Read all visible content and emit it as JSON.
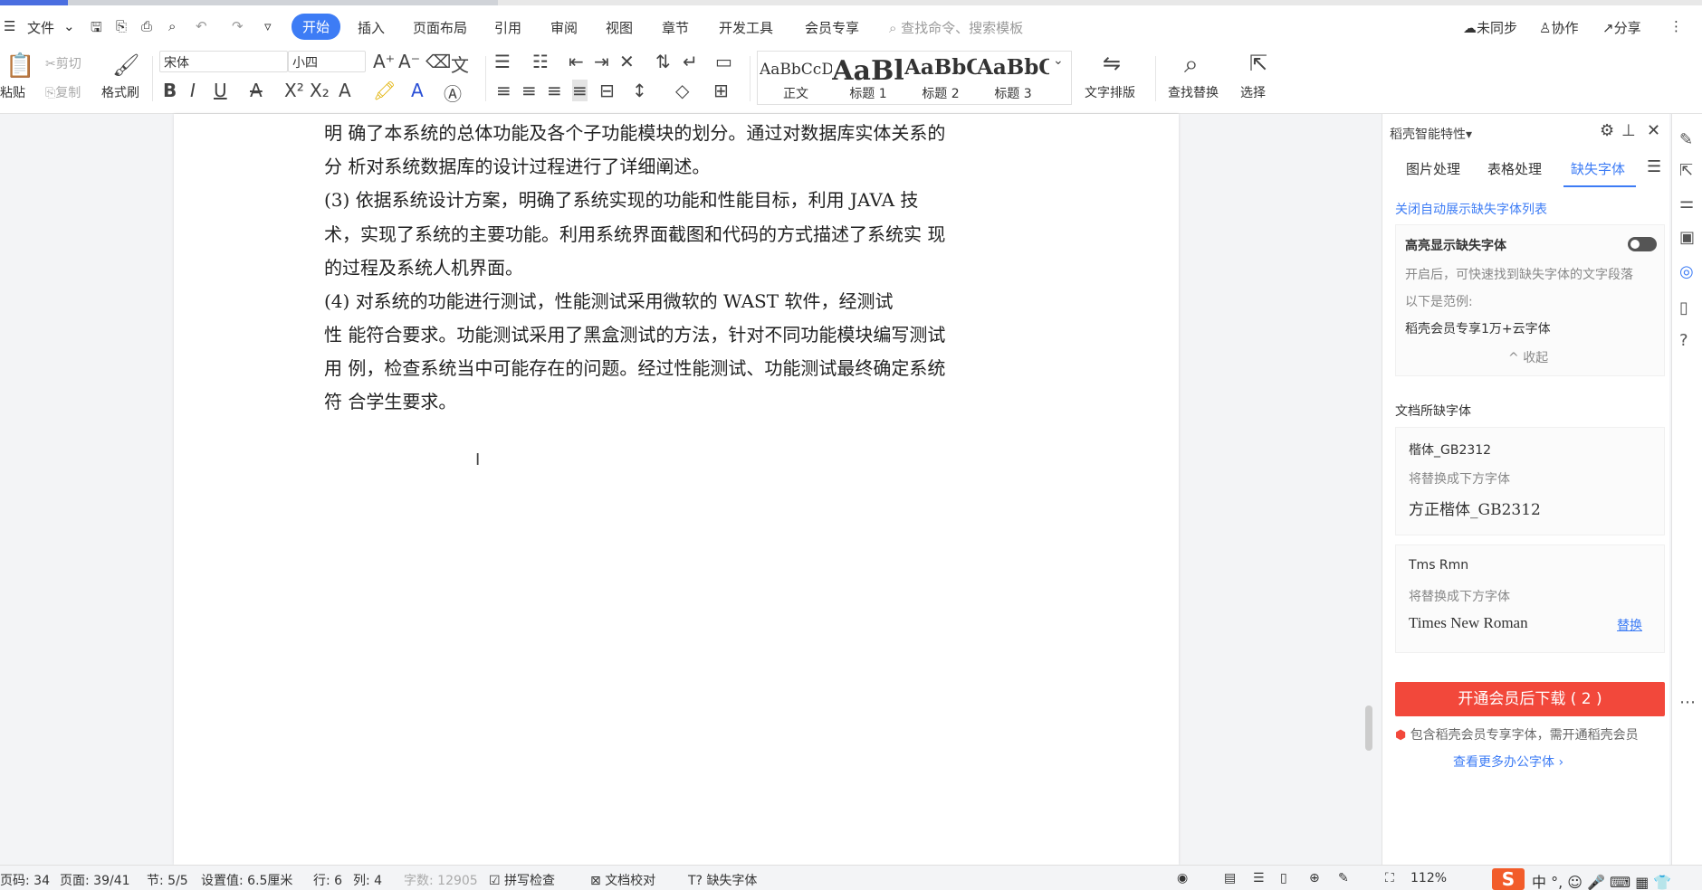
{
  "menubar": {
    "file": "文件",
    "tabs": [
      "开始",
      "插入",
      "页面布局",
      "引用",
      "审阅",
      "视图",
      "章节",
      "开发工具",
      "会员专享"
    ],
    "search_placeholder": "查找命令、搜索模板",
    "sync": "未同步",
    "collab": "协作",
    "share": "分享"
  },
  "ribbon": {
    "paste": "粘贴",
    "cut": "剪切",
    "copy": "复制",
    "format_painter": "格式刷",
    "font_name": "宋体",
    "font_size": "小四",
    "styles": [
      {
        "preview": "AaBbCcD",
        "name": "正文"
      },
      {
        "preview": "AaBl",
        "name": "标题 1"
      },
      {
        "preview": "AaBbC",
        "name": "标题 2"
      },
      {
        "preview": "AaBbC",
        "name": "标题 3"
      }
    ],
    "text_layout": "文字排版",
    "find_replace": "查找替换",
    "select": "选择"
  },
  "document": {
    "lines": [
      "明  确了本系统的总体功能及各个子功能模块的划分。通过对数据库实体关系的",
      "分  析对系统数据库的设计过程进行了详细阐述。",
      "        (3)  依据系统设计方案，明确了系统实现的功能和性能目标，利用 JAVA 技",
      "术，实现了系统的主要功能。利用系统界面截图和代码的方式描述了系统实  现",
      "的过程及系统人机界面。",
      "        (4)  对系统的功能进行测试，性能测试采用微软的  WAST  软件，经测试",
      "性  能符合要求。功能测试采用了黑盒测试的方法，针对不同功能模块编写测试",
      "用  例，检查系统当中可能存在的问题。经过性能测试、功能测试最终确定系统",
      "符  合学生要求。"
    ]
  },
  "panel": {
    "title": "稻壳智能特性",
    "tabs": [
      "图片处理",
      "表格处理",
      "缺失字体"
    ],
    "close_auto_list": "关闭自动展示缺失字体列表",
    "highlight_label": "高亮显示缺失字体",
    "highlight_desc": "开启后，可快速找到缺失字体的文字段落",
    "example_label": "以下是范例:",
    "example_text": "稻壳会员专享1万+云字体",
    "collapse": "收起",
    "missing_heading": "文档所缺字体",
    "fonts": [
      {
        "missing": "楷体_GB2312",
        "replace_hint": "将替换成下方字体",
        "replacement": "方正楷体_GB2312",
        "action": ""
      },
      {
        "missing": "Tms Rmn",
        "replace_hint": "将替换成下方字体",
        "replacement": "Times New Roman",
        "action": "替换"
      }
    ],
    "download_button": "开通会员后下载 ( 2 )",
    "member_note": "包含稻壳会员专享字体，需开通稻壳会员",
    "more_fonts": "查看更多办公字体"
  },
  "statusbar": {
    "page_num": "页码: 34",
    "page": "页面: 39/41",
    "section": "节: 5/5",
    "setting": "设置值: 6.5厘米",
    "row": "行: 6",
    "col": "列: 4",
    "word_count": "字数: 12905",
    "spell_check": "拼写检查",
    "doc_proof": "文档校对",
    "missing_font": "缺失字体",
    "zoom": "112%"
  }
}
